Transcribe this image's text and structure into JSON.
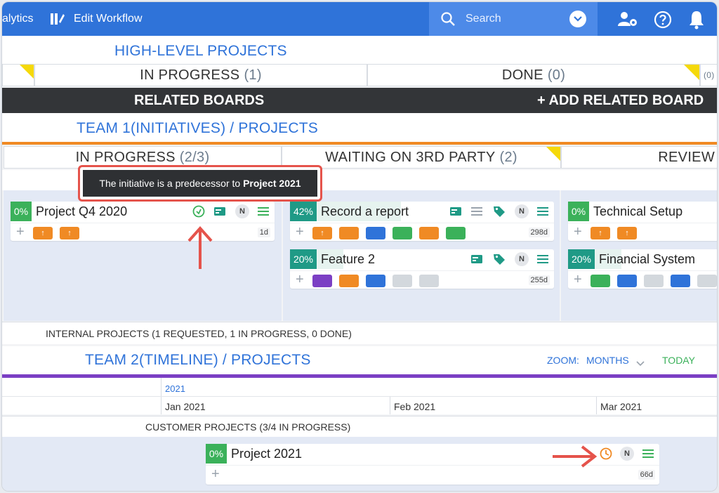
{
  "topbar": {
    "analytics_label": "alytics",
    "edit_workflow_label": "Edit Workflow",
    "search_placeholder": "Search"
  },
  "high_level": {
    "title": "HIGH-LEVEL PROJECTS",
    "columns": [
      {
        "label": "IN PROGRESS",
        "count": "(1)"
      },
      {
        "label": "DONE",
        "count": "(0)"
      },
      {
        "label": "",
        "count": "(0)"
      }
    ]
  },
  "related": {
    "title": "RELATED BOARDS",
    "add_label": "+ ADD RELATED BOARD"
  },
  "team1": {
    "title": "TEAM 1(INITIATIVES) / PROJECTS",
    "columns": [
      {
        "label": "IN PROGRESS",
        "count": "(2/3)"
      },
      {
        "label": "WAITING ON 3RD PARTY",
        "count": "(2)"
      },
      {
        "label": "REVIEW",
        "count": ""
      }
    ],
    "tooltip_prefix": "The initiative is a predecessor to ",
    "tooltip_target": "Project 2021",
    "cards": [
      {
        "pct": "0%",
        "title": "Project Q4 2020",
        "age": "1d"
      },
      {
        "pct": "42%",
        "title": "Record a report",
        "age": "298d"
      },
      {
        "pct": "20%",
        "title": "Feature 2",
        "age": "255d"
      },
      {
        "pct": "0%",
        "title": "Technical Setup",
        "age": ""
      },
      {
        "pct": "20%",
        "title": "Financial System",
        "age": ""
      }
    ],
    "n_badge": "N",
    "summary_bold": "INTERNAL PROJECTS",
    "summary_rest": " (1 REQUESTED, 1 IN PROGRESS, 0 DONE)"
  },
  "team2": {
    "title": "TEAM 2(TIMELINE) / PROJECTS",
    "zoom_label": "ZOOM:",
    "zoom_value": "MONTHS",
    "today_label": "TODAY",
    "year": "2021",
    "months": [
      "Jan 2021",
      "Feb 2021",
      "Mar 2021"
    ],
    "summary_bold": "CUSTOMER PROJECTS",
    "summary_rest": " (3/4 IN PROGRESS)",
    "card": {
      "pct": "0%",
      "title": "Project 2021",
      "age": "66d"
    }
  },
  "colors": {
    "brand_blue": "#2f73d9",
    "teal": "#1f9a86",
    "green": "#3bb15a",
    "orange": "#f08a24",
    "purple": "#7b3fc4",
    "accent_red": "#e5534b"
  }
}
